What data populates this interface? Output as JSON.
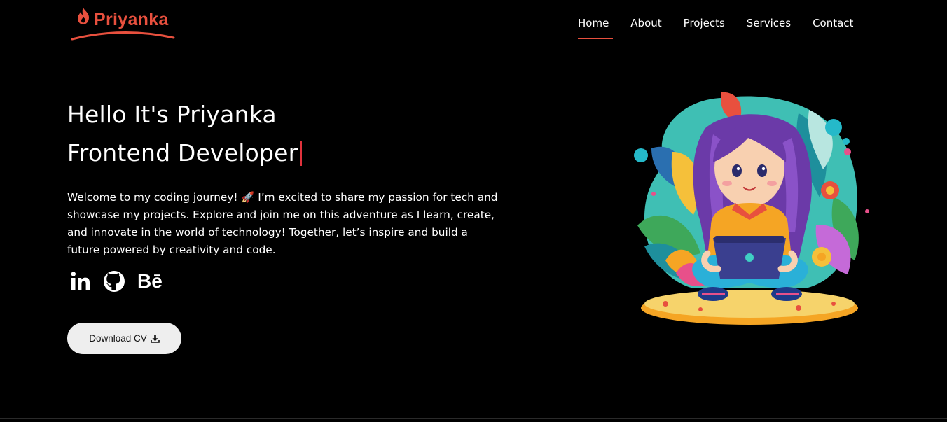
{
  "brand": {
    "name": "Priyanka",
    "accent": "#e8503e"
  },
  "nav": {
    "items": [
      {
        "label": "Home",
        "active": true
      },
      {
        "label": "About"
      },
      {
        "label": "Projects"
      },
      {
        "label": "Services"
      },
      {
        "label": "Contact"
      }
    ]
  },
  "hero": {
    "greeting": "Hello It's Priyanka",
    "role": "Frontend Developer",
    "intro": "Welcome to my coding journey! 🚀 I’m excited to share my passion for tech and showcase my projects. Explore and join me on this adventure as I learn, create, and innovate in the world of technology! Together, let’s inspire and build a future powered by creativity and code.",
    "cv_label": "Download CV"
  },
  "socials": [
    {
      "icon": "linkedin-icon"
    },
    {
      "icon": "github-icon"
    },
    {
      "icon": "behance-icon",
      "text": "Bē"
    }
  ]
}
